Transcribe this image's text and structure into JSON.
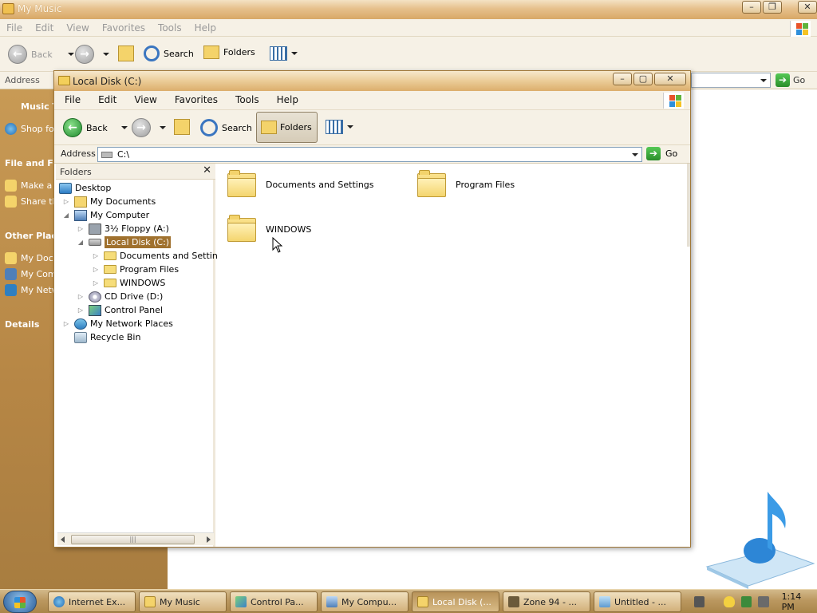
{
  "bg_window": {
    "title": "My Music",
    "menu": [
      "File",
      "Edit",
      "View",
      "Favorites",
      "Tools",
      "Help"
    ],
    "toolbar": {
      "back": "Back",
      "search": "Search",
      "folders": "Folders"
    },
    "address_label": "Address",
    "go": "Go",
    "tasks": [
      {
        "head": "Music T"
      },
      {
        "item": "Shop fo"
      },
      {
        "head": "File and Fol"
      },
      {
        "item": "Make a"
      },
      {
        "item": "Share th"
      },
      {
        "head": "Other Place"
      },
      {
        "item": "My Doc"
      },
      {
        "item": "My Com"
      },
      {
        "item": "My Netw"
      },
      {
        "head": "Details"
      }
    ]
  },
  "main_window": {
    "title": "Local Disk (C:)",
    "menu": [
      "File",
      "Edit",
      "View",
      "Favorites",
      "Tools",
      "Help"
    ],
    "toolbar": {
      "back": "Back",
      "search": "Search",
      "folders": "Folders"
    },
    "address_label": "Address",
    "address_value": "C:\\",
    "go": "Go",
    "folders_pane_title": "Folders",
    "tree": [
      {
        "label": "Desktop",
        "icon": "desktop"
      },
      {
        "label": "My Documents",
        "icon": "docs"
      },
      {
        "label": "My Computer",
        "icon": "pc"
      },
      {
        "label": "3½ Floppy (A:)",
        "icon": "floppy"
      },
      {
        "label": "Local Disk (C:)",
        "icon": "disk",
        "selected": true
      },
      {
        "label": "Documents and Settings",
        "icon": "folder"
      },
      {
        "label": "Program Files",
        "icon": "folder"
      },
      {
        "label": "WINDOWS",
        "icon": "folder"
      },
      {
        "label": "CD Drive (D:)",
        "icon": "cd"
      },
      {
        "label": "Control Panel",
        "icon": "cp"
      },
      {
        "label": "My Network Places",
        "icon": "net"
      },
      {
        "label": "Recycle Bin",
        "icon": "bin"
      }
    ],
    "items": [
      {
        "label": "Documents and Settings"
      },
      {
        "label": "Program Files"
      },
      {
        "label": "WINDOWS"
      }
    ]
  },
  "taskbar": {
    "buttons": [
      {
        "label": "Internet Ex..."
      },
      {
        "label": "My Music"
      },
      {
        "label": "Control Pa..."
      },
      {
        "label": "My Compu..."
      },
      {
        "label": "Local Disk (..."
      },
      {
        "label": "Zone 94 - ..."
      },
      {
        "label": "Untitled - ..."
      }
    ],
    "clock": "1:14 PM"
  },
  "colors": {
    "accent": "#a0712e",
    "task_pane": "#b68645",
    "taskbar": "#bb9860"
  }
}
